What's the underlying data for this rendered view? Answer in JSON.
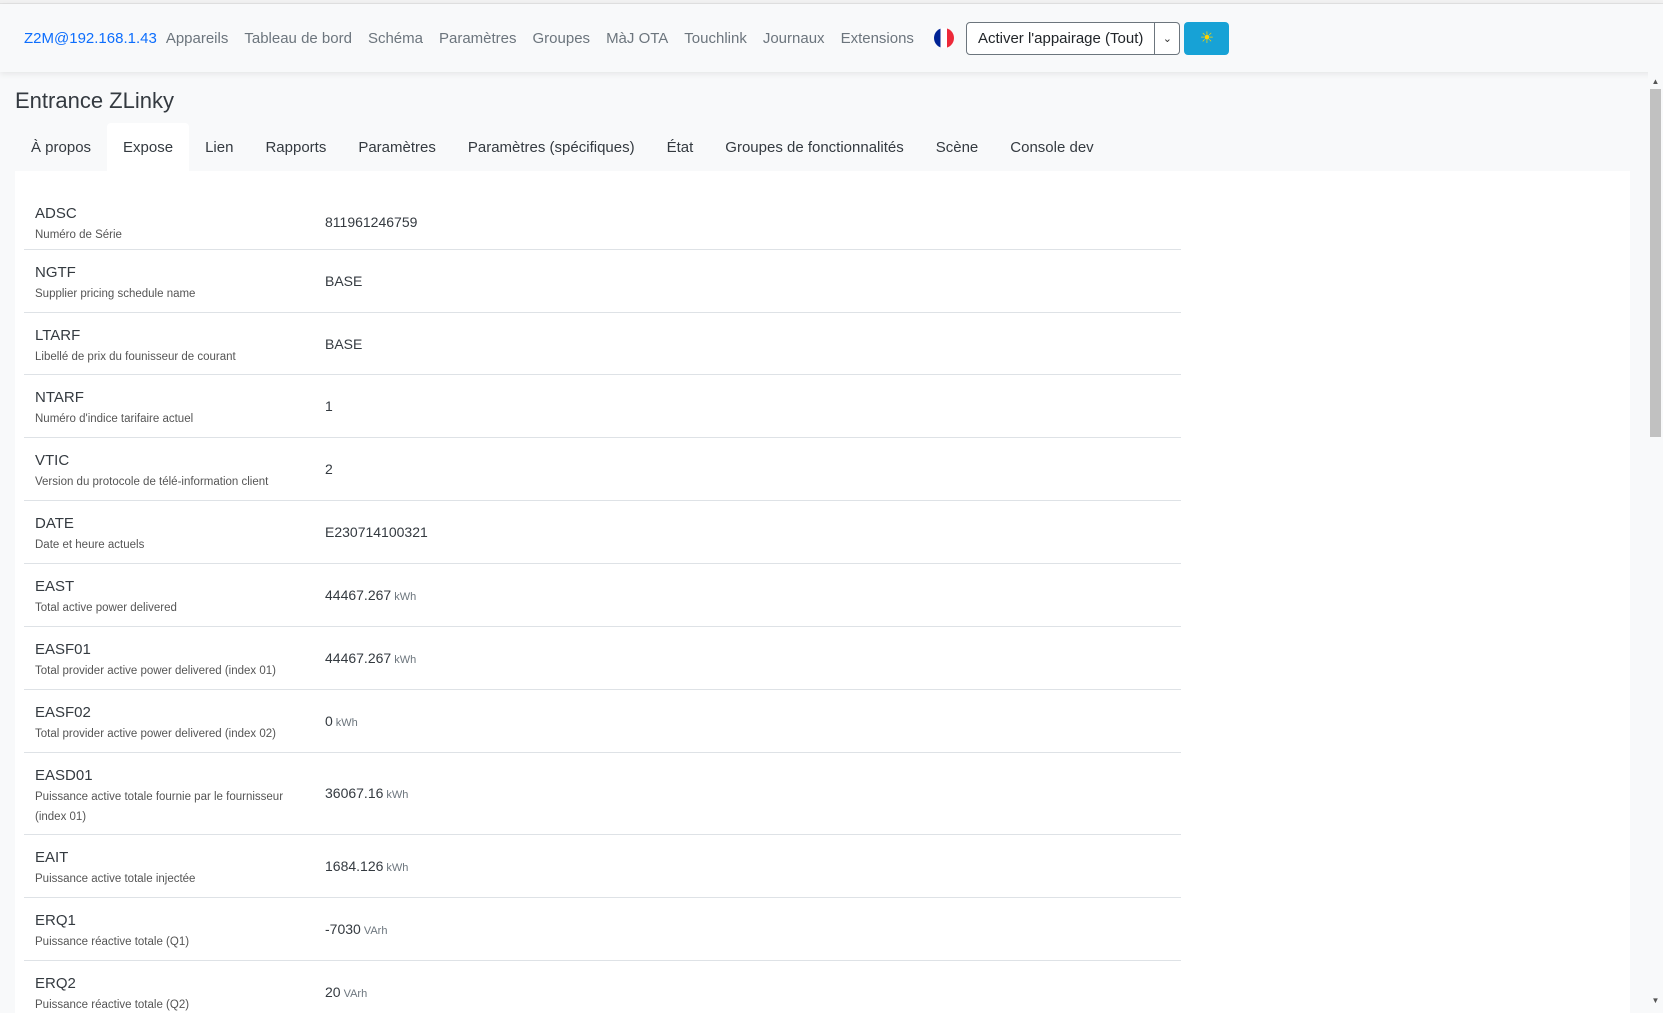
{
  "navbar": {
    "brand": "Z2M@192.168.1.43",
    "links": [
      "Appareils",
      "Tableau de bord",
      "Schéma",
      "Paramètres",
      "Groupes",
      "MàJ OTA",
      "Touchlink",
      "Journaux",
      "Extensions"
    ],
    "language_icon": "french-flag-icon",
    "pair_button": "Activer l'appairage (Tout)",
    "dropdown_icon": "chevron-down-icon",
    "permit_icon": "sun-icon"
  },
  "page": {
    "title": "Entrance ZLinky"
  },
  "tabs": [
    "À propos",
    "Expose",
    "Lien",
    "Rapports",
    "Paramètres",
    "Paramètres (spécifiques)",
    "État",
    "Groupes de fonctionnalités",
    "Scène",
    "Console dev"
  ],
  "active_tab": "Expose",
  "rows": [
    {
      "name": "ADSC",
      "desc": "Numéro de Série",
      "value": "811961246759",
      "unit": ""
    },
    {
      "name": "NGTF",
      "desc": "Supplier pricing schedule name",
      "value": "BASE",
      "unit": ""
    },
    {
      "name": "LTARF",
      "desc": "Libellé de prix du founisseur de courant",
      "value": "BASE",
      "unit": ""
    },
    {
      "name": "NTARF",
      "desc": "Numéro d'indice tarifaire actuel",
      "value": "1",
      "unit": ""
    },
    {
      "name": "VTIC",
      "desc": "Version du protocole de télé-information client",
      "value": "2",
      "unit": ""
    },
    {
      "name": "DATE",
      "desc": "Date et heure actuels",
      "value": "E230714100321",
      "unit": ""
    },
    {
      "name": "EAST",
      "desc": "Total active power delivered",
      "value": "44467.267",
      "unit": "kWh"
    },
    {
      "name": "EASF01",
      "desc": "Total provider active power delivered (index 01)",
      "value": "44467.267",
      "unit": "kWh"
    },
    {
      "name": "EASF02",
      "desc": "Total provider active power delivered (index 02)",
      "value": "0",
      "unit": "kWh"
    },
    {
      "name": "EASD01",
      "desc": "Puissance active totale fournie par le fournisseur (index 01)",
      "value": "36067.16",
      "unit": "kWh"
    },
    {
      "name": "EAIT",
      "desc": "Puissance active totale injectée",
      "value": "1684.126",
      "unit": "kWh"
    },
    {
      "name": "ERQ1",
      "desc": "Puissance réactive totale (Q1)",
      "value": "-7030",
      "unit": "VArh"
    },
    {
      "name": "ERQ2",
      "desc": "Puissance réactive totale (Q2)",
      "value": "20",
      "unit": "VArh"
    }
  ]
}
